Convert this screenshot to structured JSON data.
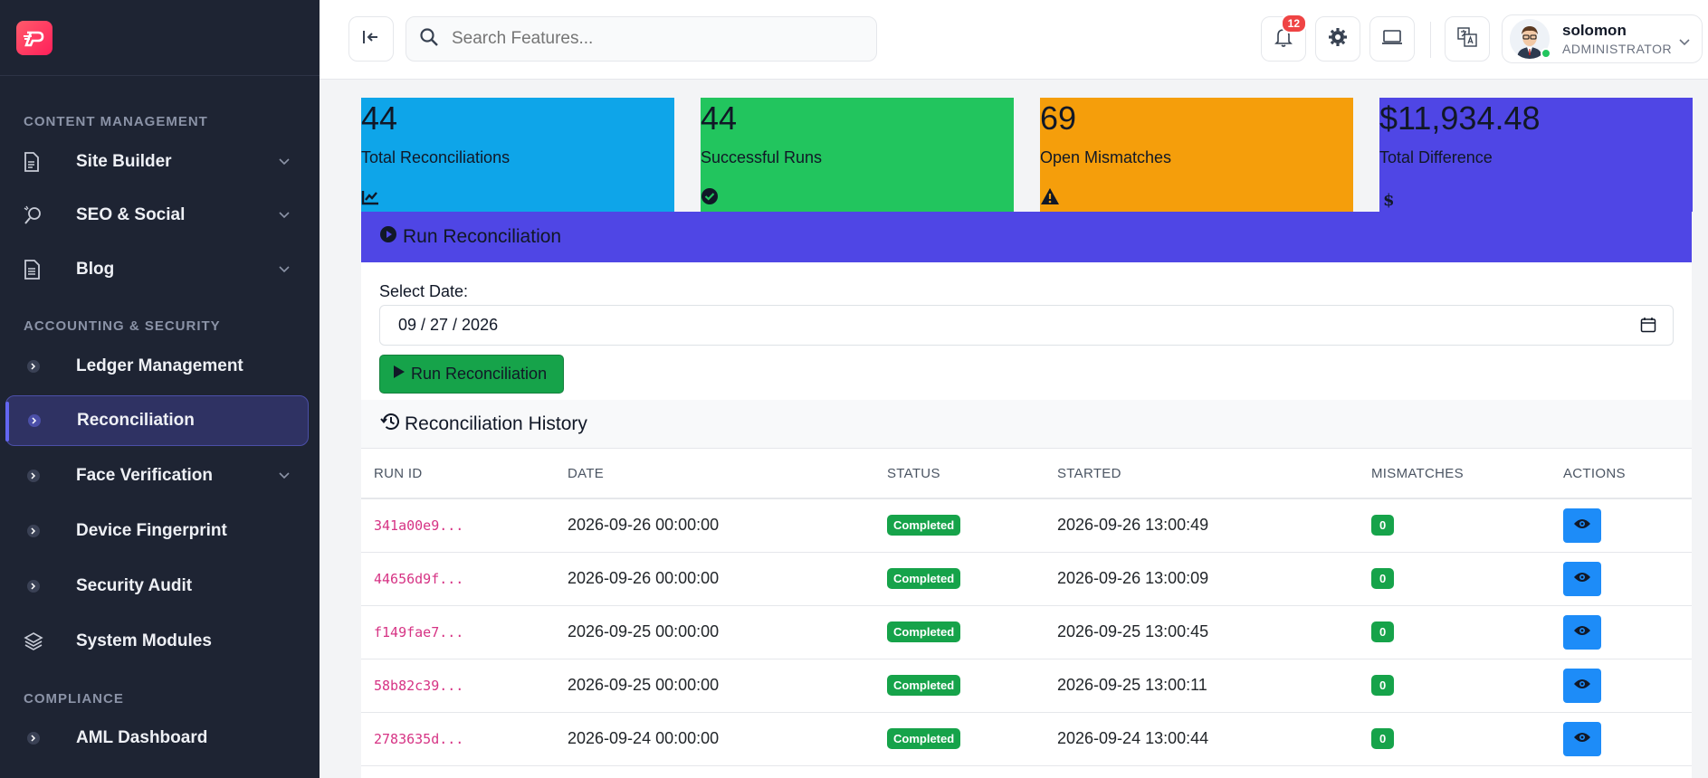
{
  "sidebar": {
    "sections": [
      {
        "title": "CONTENT MANAGEMENT"
      },
      {
        "title": "ACCOUNTING & SECURITY"
      },
      {
        "title": "COMPLIANCE"
      }
    ],
    "items": [
      {
        "label": "Site Builder",
        "icon": "document-icon",
        "has_submenu": true
      },
      {
        "label": "SEO & Social",
        "icon": "seo-icon",
        "has_submenu": true
      },
      {
        "label": "Blog",
        "icon": "blog-icon",
        "has_submenu": true
      },
      {
        "label": "Ledger Management",
        "icon": "chevron-right-circle-icon",
        "has_submenu": false
      },
      {
        "label": "Reconciliation",
        "icon": "chevron-right-circle-icon",
        "has_submenu": false,
        "active": true
      },
      {
        "label": "Face Verification",
        "icon": "chevron-right-circle-icon",
        "has_submenu": true
      },
      {
        "label": "Device Fingerprint",
        "icon": "chevron-right-circle-icon",
        "has_submenu": false
      },
      {
        "label": "Security Audit",
        "icon": "chevron-right-circle-icon",
        "has_submenu": false
      },
      {
        "label": "System Modules",
        "icon": "layers-icon",
        "has_submenu": false
      },
      {
        "label": "AML Dashboard",
        "icon": "chevron-right-circle-icon",
        "has_submenu": false
      }
    ]
  },
  "topbar": {
    "search_placeholder": "Search Features...",
    "notification_count": "12",
    "user": {
      "name": "solomon",
      "role": "ADMINISTRATOR"
    }
  },
  "stats": [
    {
      "value": "44",
      "label": "Total Reconciliations",
      "color": "#0ea5e9",
      "icon": "chart-line-icon"
    },
    {
      "value": "44",
      "label": "Successful Runs",
      "color": "#22c55e",
      "icon": "check-circle-icon"
    },
    {
      "value": "69",
      "label": "Open Mismatches",
      "color": "#f59e0b",
      "icon": "warning-icon"
    },
    {
      "value": "$11,934.48",
      "label": "Total Difference",
      "color": "#4f46e5",
      "icon": "dollar-icon"
    }
  ],
  "run_panel": {
    "title": "Run Reconciliation",
    "date_label": "Select Date:",
    "date_value": "09 / 27 / 2026",
    "button_label": "Run Reconciliation"
  },
  "history": {
    "title": "Reconciliation History",
    "columns": [
      "RUN ID",
      "DATE",
      "STATUS",
      "STARTED",
      "MISMATCHES",
      "ACTIONS"
    ],
    "rows": [
      {
        "run_id": "341a00e9...",
        "date": "2026-09-26 00:00:00",
        "status": "Completed",
        "started": "2026-09-26 13:00:49",
        "mismatches": "0"
      },
      {
        "run_id": "44656d9f...",
        "date": "2026-09-26 00:00:00",
        "status": "Completed",
        "started": "2026-09-26 13:00:09",
        "mismatches": "0"
      },
      {
        "run_id": "f149fae7...",
        "date": "2026-09-25 00:00:00",
        "status": "Completed",
        "started": "2026-09-25 13:00:45",
        "mismatches": "0"
      },
      {
        "run_id": "58b82c39...",
        "date": "2026-09-25 00:00:00",
        "status": "Completed",
        "started": "2026-09-25 13:00:11",
        "mismatches": "0"
      },
      {
        "run_id": "2783635d...",
        "date": "2026-09-24 00:00:00",
        "status": "Completed",
        "started": "2026-09-24 13:00:44",
        "mismatches": "0"
      }
    ]
  }
}
